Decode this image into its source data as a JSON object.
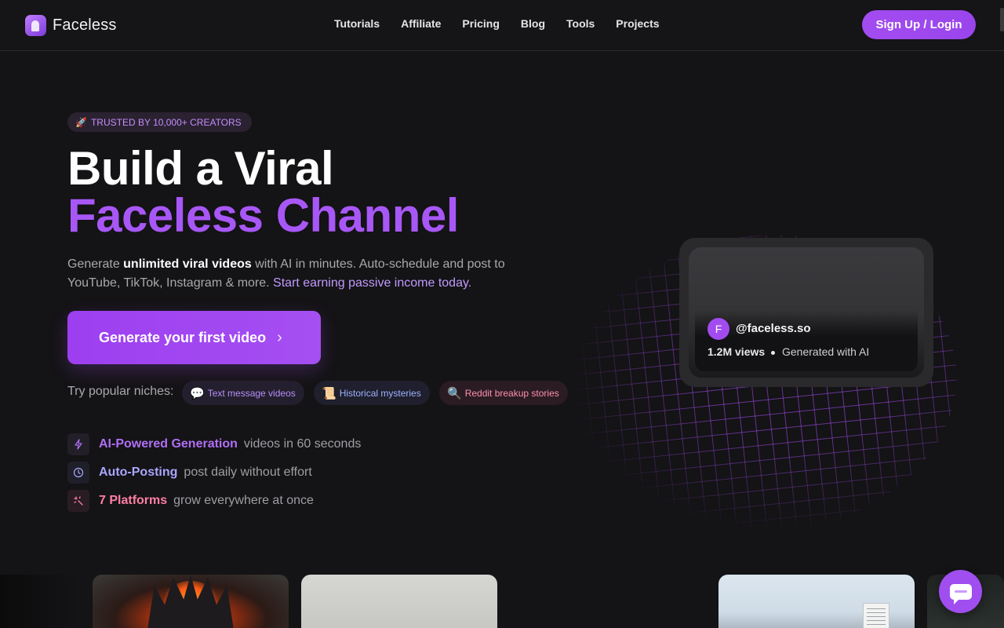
{
  "brand": {
    "name": "Faceless",
    "logo_icon": "faceless-logo-icon"
  },
  "nav": {
    "items": [
      "Tutorials",
      "Affiliate",
      "Pricing",
      "Blog",
      "Tools",
      "Projects"
    ],
    "signup_label": "Sign Up / Login"
  },
  "hero": {
    "badge_emoji": "🚀",
    "badge": "TRUSTED BY 10,000+ CREATORS",
    "title_line1": "Build a Viral",
    "title_line2": "Faceless Channel",
    "sub_part1": "Generate ",
    "sub_bold": "unlimited viral videos",
    "sub_part2": " with AI in minutes. Auto-schedule and post to YouTube, TikTok, Instagram & more. ",
    "sub_highlight": "Start earning passive income today.",
    "cta_label": "Generate your first video",
    "cta_icon": "chevron-right-icon",
    "niches_label": "Try popular niches:",
    "niches": [
      {
        "emoji": "💬",
        "label": "Text message videos"
      },
      {
        "emoji": "📜",
        "label": "Historical mysteries"
      },
      {
        "emoji": "🔍",
        "label": "Reddit breakup stories"
      }
    ],
    "features": [
      {
        "icon": "lightning-icon",
        "title": "AI-Powered Generation",
        "desc": "videos in 60 seconds"
      },
      {
        "icon": "clock-icon",
        "title": "Auto-Posting",
        "desc": "post daily without effort"
      },
      {
        "icon": "sparkle-icon",
        "title": "7 Platforms",
        "desc": "grow everywhere at once"
      }
    ]
  },
  "preview_card": {
    "avatar_letter": "F",
    "handle": "@faceless.so",
    "views": "1.2M views",
    "generated": "Generated with AI"
  },
  "gallery": {
    "thumbnails": [
      "crown-fire-thumbnail",
      "grey-scene-thumbnail",
      "city-building-thumbnail",
      "dark-scene-thumbnail"
    ]
  },
  "chat": {
    "icon": "chat-bubble-icon"
  },
  "colors": {
    "accent": "#a24cf0",
    "background": "#141315",
    "pink": "#ff7fa6",
    "indigo": "#a9a6ff"
  }
}
